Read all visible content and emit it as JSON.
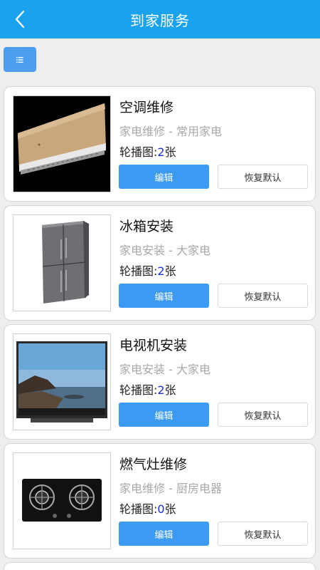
{
  "header": {
    "title": "到家服务",
    "back_icon": "chevron-left-icon"
  },
  "toolbar": {
    "menu_icon": "list-icon"
  },
  "services": [
    {
      "image": "air-conditioner-image",
      "title": "空调维修",
      "category": "家电维修 - 常用家电",
      "count_label": "轮播图:",
      "count_value": "2",
      "count_unit": "张",
      "edit_label": "编辑",
      "restore_label": "恢复默认"
    },
    {
      "image": "refrigerator-image",
      "title": "冰箱安装",
      "category": "家电安装 - 大家电",
      "count_label": "轮播图:",
      "count_value": "2",
      "count_unit": "张",
      "edit_label": "编辑",
      "restore_label": "恢复默认"
    },
    {
      "image": "television-image",
      "title": "电视机安装",
      "category": "家电安装 - 大家电",
      "count_label": "轮播图:",
      "count_value": "2",
      "count_unit": "张",
      "edit_label": "编辑",
      "restore_label": "恢复默认"
    },
    {
      "image": "gas-stove-image",
      "title": "燃气灶维修",
      "category": "家电维修 - 厨房电器",
      "count_label": "轮播图:",
      "count_value": "0",
      "count_unit": "张",
      "edit_label": "编辑",
      "restore_label": "恢复默认"
    }
  ],
  "colors": {
    "header_bg": "#19a3ee",
    "primary_button": "#3b9af2",
    "count_number": "#1a2fd6",
    "muted_text": "#a8a8a8"
  }
}
